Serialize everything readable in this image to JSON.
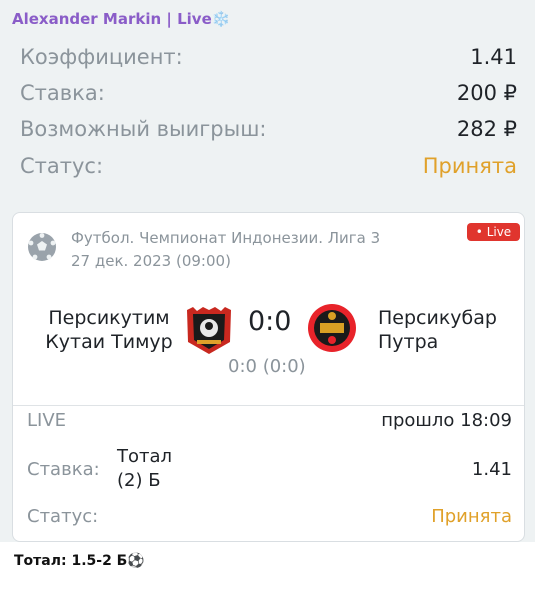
{
  "post": {
    "author": "Alexander Markin | Live",
    "snowflake": "❄️"
  },
  "summary": {
    "coef_label": "Коэффициент:",
    "coef_value": "1.41",
    "stake_label": "Ставка:",
    "stake_value": "200 ₽",
    "win_label": "Возможный выигрыш:",
    "win_value": "282 ₽",
    "status_label": "Статус:",
    "status_value": "Принята"
  },
  "match": {
    "league": "Футбол. Чемпионат Индонезии. Лига 3",
    "date": "27 дек. 2023 (09:00)",
    "live_badge": "• Live",
    "team1_line1": "Персикутим",
    "team1_line2": "Кутаи Тимур",
    "team2_line1": "Персикубар",
    "team2_line2": "Путра",
    "score": "0:0",
    "sub_score": "0:0 (0:0)"
  },
  "bet": {
    "live_label": "LIVE",
    "elapsed": "прошло 18:09",
    "stake_label": "Ставка:",
    "market_line1": "Тотал",
    "market_line2": "(2) Б",
    "odds": "1.41",
    "status_label": "Статус:",
    "status_value": "Принята"
  },
  "caption": "Тотал: 1.5-2 Б⚽",
  "colors": {
    "accent": "#e0a12a",
    "author": "#8a5dc8",
    "live": "#e0352e"
  }
}
